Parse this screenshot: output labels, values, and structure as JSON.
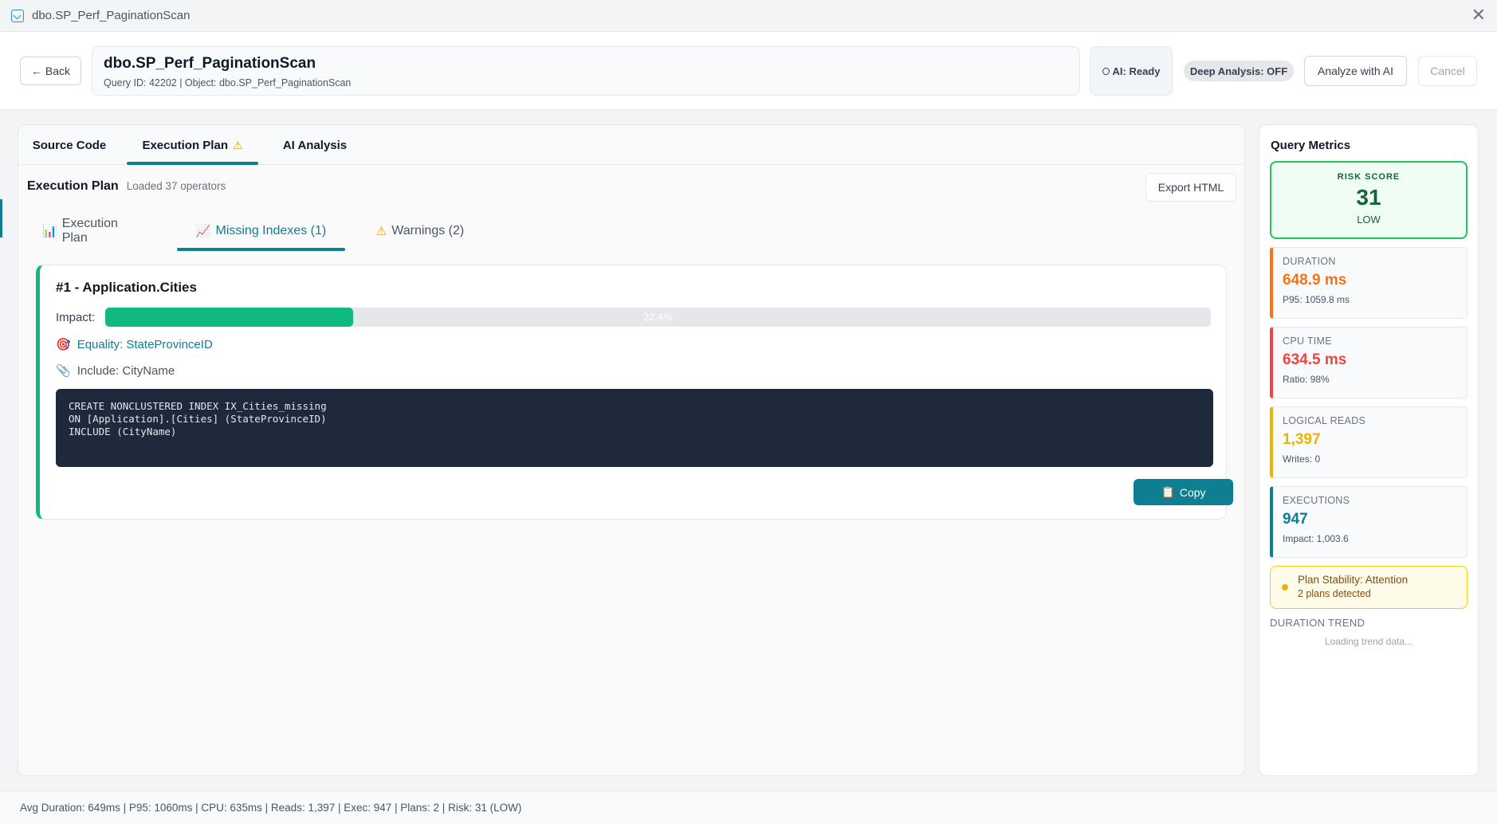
{
  "window": {
    "title": "dbo.SP_Perf_PaginationScan"
  },
  "header": {
    "back_label": "← Back",
    "query_title": "dbo.SP_Perf_PaginationScan",
    "query_subtitle": "Query ID: 42202 | Object: dbo.SP_Perf_PaginationScan",
    "ai_status": "AI: Ready",
    "deep_analysis": "Deep Analysis: OFF",
    "analyze_label": "Analyze with AI",
    "cancel_label": "Cancel"
  },
  "main_tabs": [
    {
      "label": "Source Code"
    },
    {
      "label": "Execution Plan",
      "warning_glyph": "⚠"
    },
    {
      "label": "AI Analysis"
    }
  ],
  "plan": {
    "title": "Execution Plan",
    "subtitle": "Loaded 37 operators",
    "export_label": "Export HTML"
  },
  "sub_tabs": [
    {
      "label": "Execution Plan",
      "icon": "bar-chart-icon",
      "glyph": "📊"
    },
    {
      "label": "Missing Indexes (1)",
      "icon": "chart-trend-icon",
      "glyph": "📈"
    },
    {
      "label": "Warnings (2)",
      "icon": "warning-icon",
      "glyph": "⚠"
    }
  ],
  "missing_index": {
    "title": "#1 - Application.Cities",
    "impact_label": "Impact:",
    "impact_percent": 22.4,
    "impact_text": "22.4%",
    "equality_icon": "target-icon",
    "equality_glyph": "🎯",
    "equality": "Equality: StateProvinceID",
    "include_icon": "paperclip-icon",
    "include_glyph": "📎",
    "include": "Include: CityName",
    "code_lines": [
      "CREATE NONCLUSTERED INDEX IX_Cities_missing",
      "ON [Application].[Cities] (StateProvinceID)",
      "INCLUDE (CityName)"
    ],
    "copy_icon_glyph": "📋",
    "copy_label": "Copy"
  },
  "metrics": {
    "title": "Query Metrics",
    "risk": {
      "label": "RISK SCORE",
      "value": "31",
      "level": "LOW"
    },
    "duration": {
      "label": "DURATION",
      "value": "648.9 ms",
      "sub": "P95: 1059.8 ms",
      "color": "#f97316"
    },
    "cpu": {
      "label": "CPU TIME",
      "value": "634.5 ms",
      "sub": "Ratio: 98%",
      "color": "#ef4444"
    },
    "reads": {
      "label": "LOGICAL READS",
      "value": "1,397",
      "sub": "Writes: 0",
      "color": "#eab308"
    },
    "executions": {
      "label": "EXECUTIONS",
      "value": "947",
      "sub": "Impact: 1,003.6",
      "color": "#0e7f91"
    },
    "stability": {
      "title": "Plan Stability: Attention",
      "sub": "2 plans detected"
    },
    "trend_label": "DURATION TREND",
    "trend_loading": "Loading trend data..."
  },
  "statusbar": {
    "text": "Avg Duration: 649ms | P95: 1060ms | CPU: 635ms | Reads: 1,397 | Exec: 947 | Plans: 2 | Risk: 31 (LOW)"
  }
}
